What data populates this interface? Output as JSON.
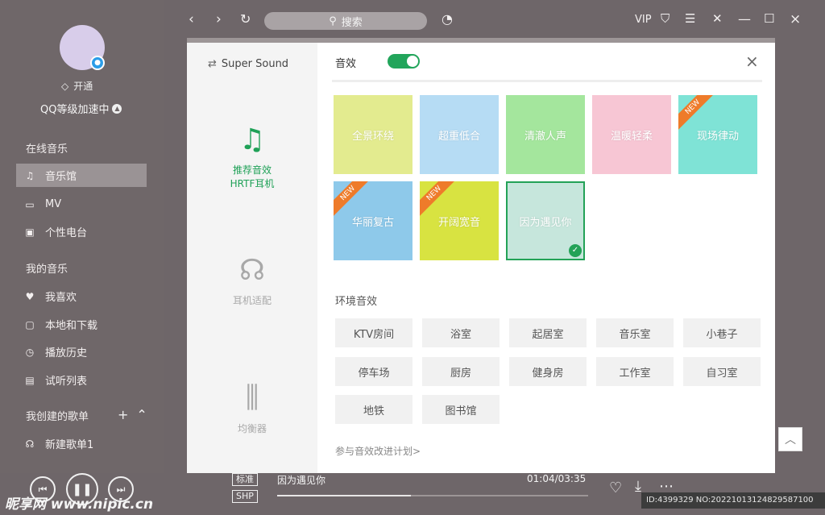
{
  "sidebar": {
    "open_label": "开通",
    "level_label": "QQ等级加速中",
    "sections": {
      "online": "在线音乐",
      "mine": "我的音乐",
      "created": "我创建的歌单"
    },
    "online_items": [
      {
        "label": "音乐馆",
        "icon": "music-note-icon"
      },
      {
        "label": "MV",
        "icon": "video-icon"
      },
      {
        "label": "个性电台",
        "icon": "radio-icon"
      }
    ],
    "my_items": [
      {
        "label": "我喜欢",
        "icon": "heart-icon"
      },
      {
        "label": "本地和下载",
        "icon": "monitor-icon"
      },
      {
        "label": "播放历史",
        "icon": "history-icon"
      },
      {
        "label": "试听列表",
        "icon": "list-icon"
      }
    ],
    "playlist_items": [
      {
        "label": "新建歌单1",
        "icon": "headphones-icon"
      }
    ]
  },
  "topbar": {
    "search_placeholder": "搜索",
    "vip_label": "VIP"
  },
  "modal": {
    "brand": "Super Sound",
    "effect_label": "音效",
    "effect_on": true,
    "left_items": [
      {
        "label": "推荐音效",
        "sublabel": "HRTF耳机",
        "icon": "music-notes-icon",
        "active": true
      },
      {
        "label": "耳机适配",
        "sublabel": "",
        "icon": "headphones-icon",
        "active": false
      },
      {
        "label": "均衡器",
        "sublabel": "",
        "icon": "equalizer-icon",
        "active": false
      }
    ],
    "presets": [
      {
        "label": "全景环绕",
        "color": "#e3eb8f",
        "new": false,
        "selected": false
      },
      {
        "label": "超重低合",
        "color": "#b6dcf4",
        "new": false,
        "selected": false
      },
      {
        "label": "清澈人声",
        "color": "#a4e69d",
        "new": false,
        "selected": false
      },
      {
        "label": "温暖轻柔",
        "color": "#f7c6d4",
        "new": false,
        "selected": false
      },
      {
        "label": "现场律动",
        "color": "#7fe3d6",
        "new": true,
        "selected": false
      },
      {
        "label": "华丽复古",
        "color": "#8ec9ea",
        "new": true,
        "selected": false
      },
      {
        "label": "开阔宽音",
        "color": "#d8e341",
        "new": true,
        "selected": false
      },
      {
        "label": "因为遇见你",
        "color": "#c6e6dc",
        "new": false,
        "selected": true
      }
    ],
    "new_tag": "NEW",
    "env_title": "环境音效",
    "env_items": [
      "KTV房间",
      "浴室",
      "起居室",
      "音乐室",
      "小巷子",
      "停车场",
      "厨房",
      "健身房",
      "工作室",
      "自习室",
      "地铁",
      "图书馆"
    ],
    "join_link": "参与音效改进计划>"
  },
  "player": {
    "quality_1": "标准",
    "quality_2": "SHP",
    "song_title": "因为遇见你",
    "time": "01:04/03:35",
    "progress": 0.43
  },
  "watermark": "昵享网 www.nipic.cn",
  "id_text": "ID:4399329 NO:20221013124829587100"
}
